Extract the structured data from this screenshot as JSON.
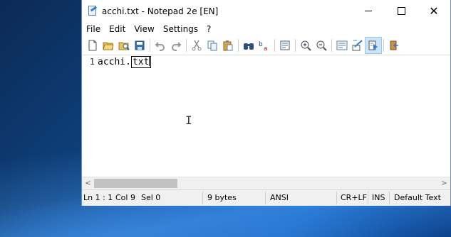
{
  "window": {
    "title": "acchi.txt - Notepad 2e [EN]"
  },
  "menu": [
    "File",
    "Edit",
    "View",
    "Settings",
    "?"
  ],
  "toolbar": {
    "icons": [
      "new-file-icon",
      "open-folder-icon",
      "browse-icon",
      "save-icon",
      "undo-icon",
      "redo-icon",
      "cut-icon",
      "copy-icon",
      "paste-icon",
      "find-icon",
      "replace-icon",
      "goto-icon",
      "zoom-in-icon",
      "zoom-out-icon",
      "word-wrap-icon",
      "scheme-icon",
      "custom-scheme-icon",
      "exit-icon"
    ]
  },
  "editor": {
    "line_number": "1",
    "text_before": "acchi.",
    "text_highlight": "txt"
  },
  "status": {
    "position": "Ln 1 : 1",
    "column": "Col 9",
    "selection": "Sel 0",
    "size": "9 bytes",
    "encoding": "ANSI",
    "line_endings": "CR+LF",
    "insert_mode": "INS",
    "scheme": "Default Text"
  },
  "colors": {
    "accent": "#0a4a9a",
    "active_button": "#cce4f7"
  }
}
